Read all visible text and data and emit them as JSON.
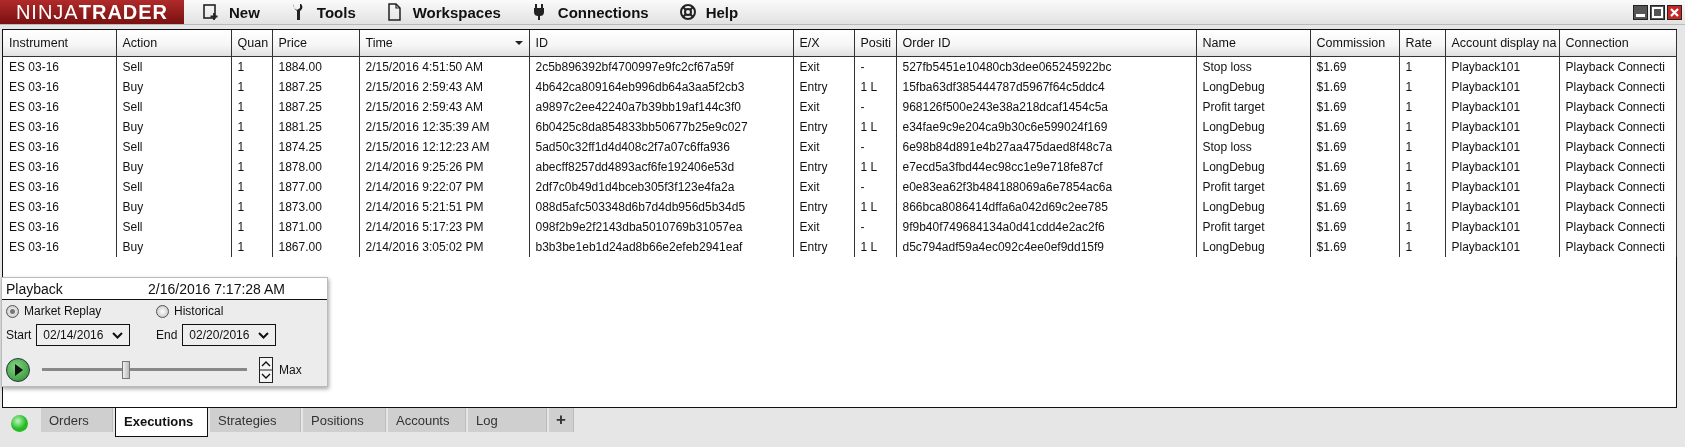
{
  "menu_bar": {
    "logo": "NINJA**TRADER**",
    "items": [
      {
        "label": "New"
      },
      {
        "label": "Tools"
      },
      {
        "label": "Workspaces"
      },
      {
        "label": "Connections"
      },
      {
        "label": "Help"
      }
    ]
  },
  "table": {
    "columns": [
      {
        "label": "Instrument",
        "sorted": false
      },
      {
        "label": "Action",
        "sorted": false
      },
      {
        "label": "Quan",
        "sorted": false
      },
      {
        "label": "Price",
        "sorted": false
      },
      {
        "label": "Time",
        "sorted": true
      },
      {
        "label": "ID",
        "sorted": false
      },
      {
        "label": "E/X",
        "sorted": false
      },
      {
        "label": "Positi",
        "sorted": false
      },
      {
        "label": "Order ID",
        "sorted": false
      },
      {
        "label": "Name",
        "sorted": false
      },
      {
        "label": "Commission",
        "sorted": false
      },
      {
        "label": "Rate",
        "sorted": false
      },
      {
        "label": "Account display na",
        "sorted": false
      },
      {
        "label": "Connection",
        "sorted": false
      }
    ],
    "rows": [
      [
        "ES 03-16",
        "Sell",
        "1",
        "1884.00",
        "2/15/2016 4:51:50 AM",
        "2c5b896392bf4700997e9fc2cf67a59f",
        "Exit",
        "-",
        "527fb5451e10480cb3dee065245922bc",
        "Stop loss",
        "$1.69",
        "1",
        "Playback101",
        "Playback Connecti"
      ],
      [
        "ES 03-16",
        "Buy",
        "1",
        "1887.25",
        "2/15/2016 2:59:43 AM",
        "4b642ca809164eb996db64a3aa5f2cb3",
        "Entry",
        "1 L",
        "15fba63df385444787d5967f64c5ddc4",
        "LongDebug",
        "$1.69",
        "1",
        "Playback101",
        "Playback Connecti"
      ],
      [
        "ES 03-16",
        "Sell",
        "1",
        "1887.25",
        "2/15/2016 2:59:43 AM",
        "a9897c2ee42240a7b39bb19af144c3f0",
        "Exit",
        "-",
        "968126f500e243e38a218dcaf1454c5a",
        "Profit target",
        "$1.69",
        "1",
        "Playback101",
        "Playback Connecti"
      ],
      [
        "ES 03-16",
        "Buy",
        "1",
        "1881.25",
        "2/15/2016 12:35:39 AM",
        "6b0425c8da854833bb50677b25e9c027",
        "Entry",
        "1 L",
        "e34fae9c9e204ca9b30c6e599024f169",
        "LongDebug",
        "$1.69",
        "1",
        "Playback101",
        "Playback Connecti"
      ],
      [
        "ES 03-16",
        "Sell",
        "1",
        "1874.25",
        "2/15/2016 12:12:23 AM",
        "5ad50c32ff1d4d408c2f7a07c6ffa936",
        "Exit",
        "-",
        "6e98b84d891e4b27aa475daed8f48c7a",
        "Stop loss",
        "$1.69",
        "1",
        "Playback101",
        "Playback Connecti"
      ],
      [
        "ES 03-16",
        "Buy",
        "1",
        "1878.00",
        "2/14/2016 9:25:26 PM",
        "abecff8257dd4893acf6fe192406e53d",
        "Entry",
        "1 L",
        "e7ecd5a3fbd44ec98cc1e9e718fe87cf",
        "LongDebug",
        "$1.69",
        "1",
        "Playback101",
        "Playback Connecti"
      ],
      [
        "ES 03-16",
        "Sell",
        "1",
        "1877.00",
        "2/14/2016 9:22:07 PM",
        "2df7c0b49d1d4bceb305f3f123e4fa2a",
        "Exit",
        "-",
        "e0e83ea62f3b484188069a6e7854ac6a",
        "Profit target",
        "$1.69",
        "1",
        "Playback101",
        "Playback Connecti"
      ],
      [
        "ES 03-16",
        "Buy",
        "1",
        "1873.00",
        "2/14/2016 5:21:51 PM",
        "088d5afc503348d6b7d4db956d5b34d5",
        "Entry",
        "1 L",
        "866bca8086414dffa6a042d69c2ee785",
        "LongDebug",
        "$1.69",
        "1",
        "Playback101",
        "Playback Connecti"
      ],
      [
        "ES 03-16",
        "Sell",
        "1",
        "1871.00",
        "2/14/2016 5:17:23 PM",
        "098f2b9e2f2143dba5010769b31057ea",
        "Exit",
        "-",
        "9f9b40f749684134a0d41cdd4e2ac2f6",
        "Profit target",
        "$1.69",
        "1",
        "Playback101",
        "Playback Connecti"
      ],
      [
        "ES 03-16",
        "Buy",
        "1",
        "1867.00",
        "2/14/2016 3:05:02 PM",
        "b3b3be1eb1d24ad8b66e2efeb2941eaf",
        "Entry",
        "1 L",
        "d5c794adf59a4ec092c4ee0ef9dd15f9",
        "LongDebug",
        "$1.69",
        "1",
        "Playback101",
        "Playback Connecti"
      ]
    ]
  },
  "playback": {
    "title": "Playback",
    "clock": "2/16/2016 7:17:28 AM",
    "modes": [
      {
        "label": "Market Replay",
        "selected": true
      },
      {
        "label": "Historical",
        "selected": false
      }
    ],
    "start": {
      "label": "Start",
      "value": "02/14/2016"
    },
    "end": {
      "label": "End",
      "value": "02/20/2016"
    },
    "speed": {
      "level": 0.41,
      "label": "Max"
    }
  },
  "bottom_tabs": {
    "connected": true,
    "tabs": [
      {
        "label": "Orders",
        "selected": false
      },
      {
        "label": "Executions",
        "selected": true
      },
      {
        "label": "Strategies",
        "selected": false
      },
      {
        "label": "Positions",
        "selected": false
      },
      {
        "label": "Accounts",
        "selected": false
      },
      {
        "label": "Log",
        "selected": false
      }
    ],
    "add": "+"
  }
}
